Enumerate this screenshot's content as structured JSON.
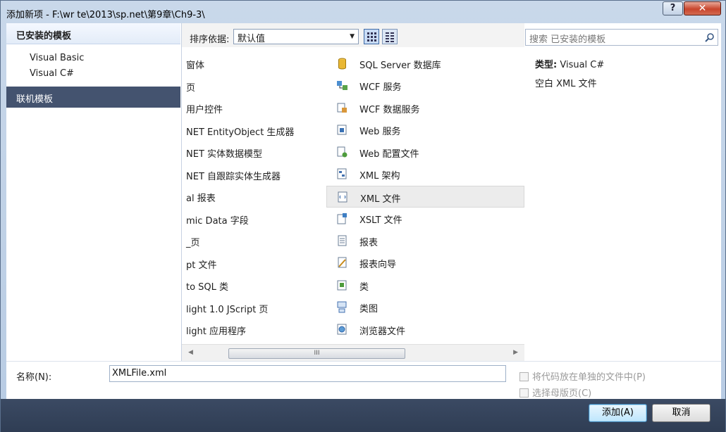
{
  "window": {
    "title": "添加新项 - F:\\wr te\\2013\\sp.net\\第9章\\Ch9-3\\",
    "help_label": "?",
    "close_label": "✕"
  },
  "left_panel": {
    "header": "已安装的模板",
    "items": [
      {
        "label": "Visual Basic"
      },
      {
        "label": "Visual C#"
      }
    ],
    "online": "联机模板"
  },
  "sort": {
    "label": "排序依据:",
    "value": "默认值"
  },
  "templates_left": [
    "窗体",
    "页",
    "用户控件",
    "NET EntityObject 生成器",
    "NET 实体数据模型",
    "NET 自跟踪实体生成器",
    "al 报表",
    "mic Data 字段",
    "_页",
    "pt 文件",
    "to SQL 类",
    "light 1.0 JScript 页",
    "light 应用程序"
  ],
  "templates_right": [
    {
      "label": "SQL Server 数据库",
      "icon": "database-icon"
    },
    {
      "label": "WCF 服务",
      "icon": "wcf-service-icon"
    },
    {
      "label": "WCF 数据服务",
      "icon": "wcf-data-service-icon"
    },
    {
      "label": "Web 服务",
      "icon": "web-service-icon"
    },
    {
      "label": "Web 配置文件",
      "icon": "web-config-icon"
    },
    {
      "label": "XML 架构",
      "icon": "xml-schema-icon"
    },
    {
      "label": "XML 文件",
      "icon": "xml-file-icon",
      "selected": true
    },
    {
      "label": "XSLT 文件",
      "icon": "xslt-file-icon"
    },
    {
      "label": "报表",
      "icon": "report-icon"
    },
    {
      "label": "报表向导",
      "icon": "report-wizard-icon"
    },
    {
      "label": "类",
      "icon": "class-icon"
    },
    {
      "label": "类图",
      "icon": "class-diagram-icon"
    },
    {
      "label": "浏览器文件",
      "icon": "browser-file-icon"
    }
  ],
  "scrollbar": {
    "thumb_label": "III"
  },
  "search": {
    "placeholder": "搜索 已安装的模板"
  },
  "info": {
    "type_key": "类型:",
    "type_value": "Visual C#",
    "description": "空白 XML 文件"
  },
  "bottom": {
    "name_label": "名称(N):",
    "name_value": "XMLFile.xml",
    "checkbox_separate": "将代码放在单独的文件中(P)",
    "checkbox_master": "选择母版页(C)"
  },
  "buttons": {
    "add": "添加(A)",
    "cancel": "取消"
  }
}
